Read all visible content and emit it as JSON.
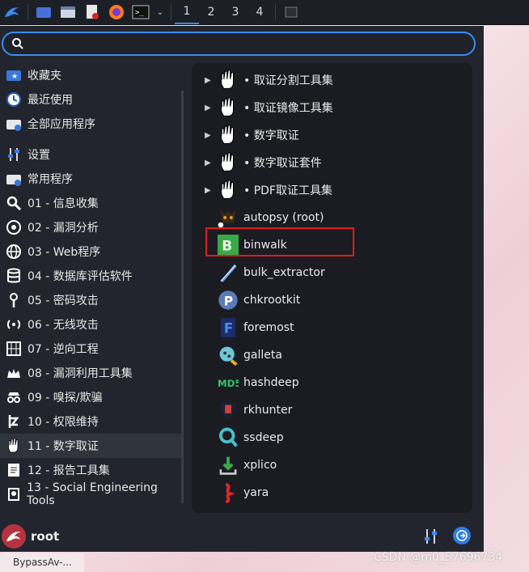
{
  "taskbar": {
    "workspaces": [
      "1",
      "2",
      "3",
      "4"
    ]
  },
  "search": {
    "placeholder": ""
  },
  "categories": [
    {
      "label": "收藏夹",
      "icon": "star-folder-icon"
    },
    {
      "label": "最近使用",
      "icon": "clock-icon"
    },
    {
      "label": "全部应用程序",
      "icon": "folder-download-icon"
    },
    {
      "label": "设置",
      "icon": "sliders-icon"
    },
    {
      "label": "常用程序",
      "icon": "folder-download-icon"
    },
    {
      "label": "01 - 信息收集",
      "icon": "magnifier-icon"
    },
    {
      "label": "02 - 漏洞分析",
      "icon": "target-icon"
    },
    {
      "label": "03 - Web程序",
      "icon": "globe-icon"
    },
    {
      "label": "04 - 数据库评估软件",
      "icon": "database-icon"
    },
    {
      "label": "05 - 密码攻击",
      "icon": "key-icon"
    },
    {
      "label": "06 - 无线攻击",
      "icon": "wireless-icon"
    },
    {
      "label": "07 - 逆向工程",
      "icon": "grid-icon"
    },
    {
      "label": "08 - 漏洞利用工具集",
      "icon": "crown-icon"
    },
    {
      "label": "09 - 嗅探/欺骗",
      "icon": "spy-icon"
    },
    {
      "label": "10 - 权限维持",
      "icon": "ladder-icon"
    },
    {
      "label": "11 - 数字取证",
      "icon": "hand-icon"
    },
    {
      "label": "12 - 报告工具集",
      "icon": "document-icon"
    },
    {
      "label": "13 - Social Engineering Tools",
      "icon": "social-icon"
    }
  ],
  "selected_category": "11 - 数字取证",
  "apps": [
    {
      "label": "• 取证分割工具集",
      "submenu": true,
      "icon": "hand-icon"
    },
    {
      "label": "• 取证镜像工具集",
      "submenu": true,
      "icon": "hand-icon"
    },
    {
      "label": "• 数字取证",
      "submenu": true,
      "icon": "hand-icon"
    },
    {
      "label": "• 数字取证套件",
      "submenu": true,
      "icon": "hand-icon"
    },
    {
      "label": "• PDF取证工具集",
      "submenu": true,
      "icon": "hand-icon"
    },
    {
      "label": "autopsy (root)",
      "submenu": false,
      "icon": "autopsy-icon"
    },
    {
      "label": "binwalk",
      "submenu": false,
      "icon": "binwalk-icon"
    },
    {
      "label": "bulk_extractor",
      "submenu": false,
      "icon": "bulk-extractor-icon"
    },
    {
      "label": "chkrootkit",
      "submenu": false,
      "icon": "chkrootkit-icon"
    },
    {
      "label": "foremost",
      "submenu": false,
      "icon": "foremost-icon"
    },
    {
      "label": "galleta",
      "submenu": false,
      "icon": "galleta-icon"
    },
    {
      "label": "hashdeep",
      "submenu": false,
      "icon": "hashdeep-icon"
    },
    {
      "label": "rkhunter",
      "submenu": false,
      "icon": "rkhunter-icon"
    },
    {
      "label": "ssdeep",
      "submenu": false,
      "icon": "ssdeep-icon"
    },
    {
      "label": "xplico",
      "submenu": false,
      "icon": "xplico-icon"
    },
    {
      "label": "yara",
      "submenu": false,
      "icon": "yara-icon"
    }
  ],
  "highlighted_app": "autopsy (root)",
  "footer": {
    "user": "root"
  },
  "bottom_task": "BypassAv-...",
  "watermark": "CSDN @m0_57696734",
  "colors": {
    "accent": "#3a8cf0",
    "highlight": "#e01c1c",
    "panel": "#22252d"
  }
}
